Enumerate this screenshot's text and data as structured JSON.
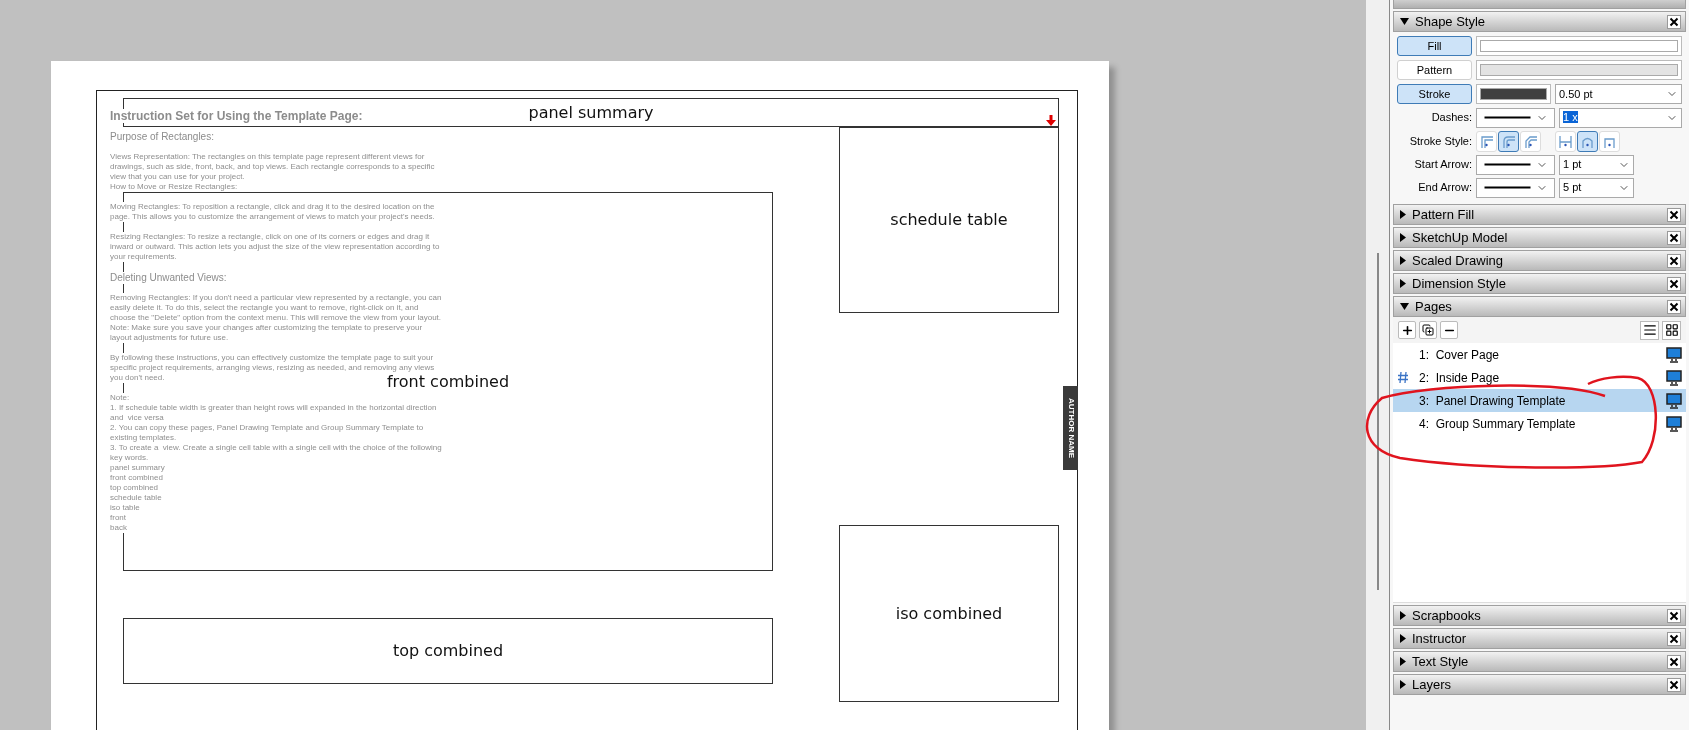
{
  "canvas": {
    "page": {
      "instructions": {
        "title": "Instruction Set for Using the Template Page:",
        "blocks": [
          {
            "kind": "heading",
            "lines": [
              "Purpose of Rectangles:"
            ]
          },
          {
            "kind": "paragraph",
            "lines": [
              "Views Representation: The rectangles on this template page represent different views for",
              "drawings, such as side, front, back, and top views. Each rectangle corresponds to a specific",
              "view that you can use for your project.",
              "How to Move or Resize Rectangles:"
            ]
          },
          {
            "kind": "paragraph",
            "lines": [
              "Moving Rectangles: To reposition a rectangle, click and drag it to the desired location on the",
              "page. This allows you to customize the arrangement of views to match your project's needs."
            ]
          },
          {
            "kind": "paragraph",
            "lines": [
              "Resizing Rectangles: To resize a rectangle, click on one of its corners or edges and drag it",
              "inward or outward. This action lets you adjust the size of the view representation according to",
              "your requirements."
            ]
          },
          {
            "kind": "heading",
            "lines": [
              "Deleting Unwanted Views:"
            ]
          },
          {
            "kind": "paragraph",
            "lines": [
              "Removing Rectangles: If you don't need a particular view represented by a rectangle, you can",
              "easily delete it. To do this, select the rectangle you want to remove, right-click on it, and",
              "choose the \"Delete\" option from the context menu. This will remove the view from your layout.",
              "Note: Make sure you save your changes after customizing the template to preserve your",
              "layout adjustments for future use."
            ]
          },
          {
            "kind": "paragraph",
            "lines": [
              "By following these instructions, you can effectively customize the template page to suit your",
              "specific project requirements, arranging views, resizing as needed, and removing any views",
              "you don't need."
            ]
          },
          {
            "kind": "paragraph",
            "lines": [
              "Note:",
              "1. If schedule table width is greater than height rows will expanded in the horizontal direction",
              "and  vice versa",
              "2. You can copy these pages, Panel Drawing Template and Group Summary Template to",
              "existing templates.",
              "3. To create a  view. Create a single cell table with a single cell with the choice of the following",
              "key words.",
              "panel summary",
              "front combined",
              "top combined",
              "schedule table",
              "iso table",
              "front",
              "back"
            ]
          }
        ]
      },
      "views": [
        {
          "label": "panel summary"
        },
        {
          "label": "schedule table"
        },
        {
          "label": "front combined"
        },
        {
          "label": "top combined"
        },
        {
          "label": "iso combined"
        }
      ],
      "author_tag": "AUTHOR NAME"
    }
  },
  "panels": [
    {
      "kind": "shape_style",
      "title": "Shape Style",
      "expanded": true,
      "rows": [
        {
          "kind": "toggle",
          "label": "Fill",
          "selected": true,
          "color": "#ffffff"
        },
        {
          "kind": "toggle",
          "label": "Pattern",
          "selected": false,
          "color": "#e3e3e3"
        },
        {
          "kind": "toggle",
          "label": "Stroke",
          "selected": true,
          "color": "#404040",
          "value": "0.50 pt"
        },
        {
          "kind": "line",
          "label": "Dashes:",
          "value": "1 x",
          "highlighted": true
        },
        {
          "kind": "style_buttons",
          "label": "Stroke Style:",
          "groups": [
            [
              {
                "selected": false
              },
              {
                "selected": true
              },
              {
                "selected": false
              }
            ],
            [
              {
                "selected": false
              },
              {
                "selected": true
              },
              {
                "selected": false
              }
            ]
          ]
        },
        {
          "kind": "line",
          "label": "Start Arrow:",
          "value": "1 pt",
          "highlighted": false
        },
        {
          "kind": "line",
          "label": "End Arrow:",
          "value": "5 pt",
          "highlighted": false
        }
      ]
    },
    {
      "title": "Pattern Fill",
      "expanded": false
    },
    {
      "title": "SketchUp Model",
      "expanded": false
    },
    {
      "title": "Scaled Drawing",
      "expanded": false
    },
    {
      "title": "Dimension Style",
      "expanded": false
    },
    {
      "kind": "pages",
      "title": "Pages",
      "expanded": true,
      "items": [
        {
          "label": "1:  Cover Page",
          "current": false,
          "selected": false
        },
        {
          "label": "2:  Inside Page",
          "current": true,
          "selected": false
        },
        {
          "label": "3:  Panel Drawing Template",
          "current": false,
          "selected": true
        },
        {
          "label": "4:  Group Summary Template",
          "current": false,
          "selected": false
        }
      ]
    },
    {
      "title": "Scrapbooks",
      "expanded": false
    },
    {
      "title": "Instructor",
      "expanded": false
    },
    {
      "title": "Text Style",
      "expanded": false
    },
    {
      "title": "Layers",
      "expanded": false
    }
  ]
}
